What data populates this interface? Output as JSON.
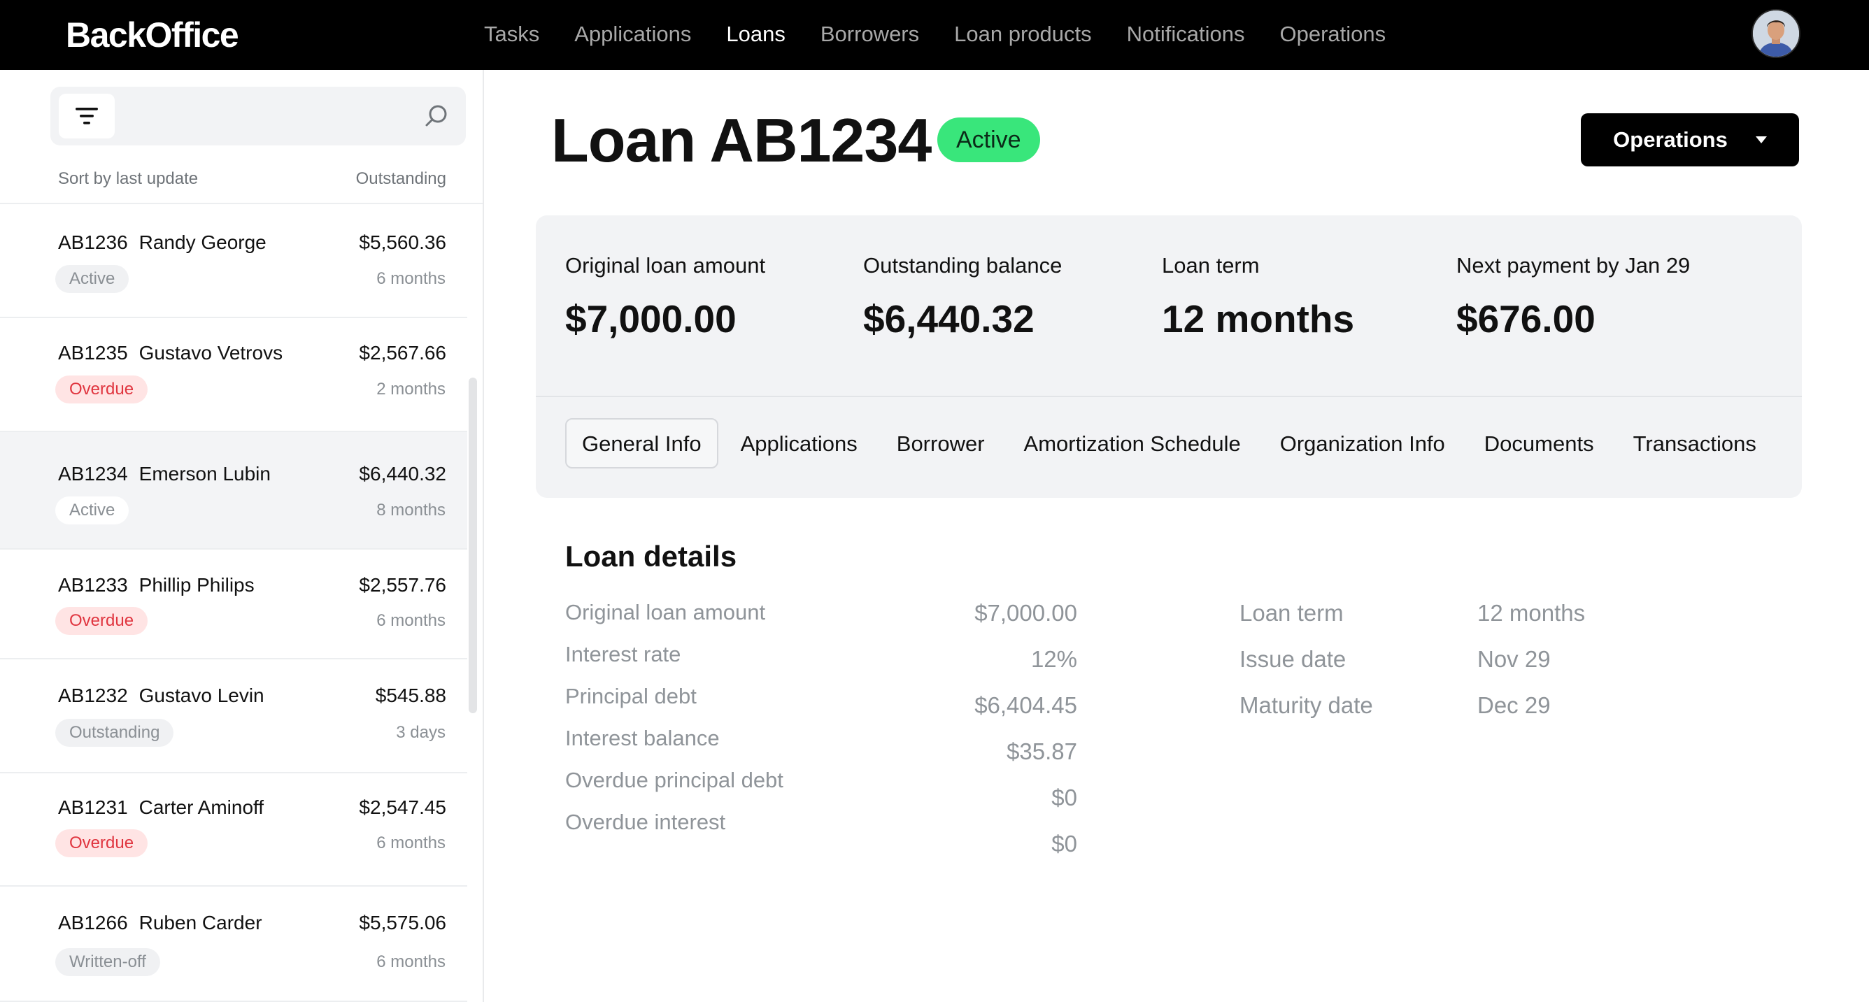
{
  "app": {
    "brand": "BackOffice"
  },
  "nav": {
    "items": [
      "Tasks",
      "Applications",
      "Loans",
      "Borrowers",
      "Loan products",
      "Notifications",
      "Operations"
    ],
    "active": "Loans"
  },
  "user": {
    "avatar": "user-avatar"
  },
  "sidebar": {
    "filter_icon": "filter-icon",
    "search_icon": "search-icon",
    "sort_label": "Sort by last update",
    "outstanding_label": "Outstanding",
    "loans": [
      {
        "id": "AB1236",
        "name": "Randy George",
        "amount": "$5,560.36",
        "status": "Active",
        "term": "6 months",
        "selected": false
      },
      {
        "id": "AB1235",
        "name": "Gustavo Vetrovs",
        "amount": "$2,567.66",
        "status": "Overdue",
        "term": "2 months",
        "selected": false
      },
      {
        "id": "AB1234",
        "name": "Emerson Lubin",
        "amount": "$6,440.32",
        "status": "Active",
        "term": "8 months",
        "selected": true
      },
      {
        "id": "AB1233",
        "name": "Phillip Philips",
        "amount": "$2,557.76",
        "status": "Overdue",
        "term": "6 months",
        "selected": false
      },
      {
        "id": "AB1232",
        "name": "Gustavo Levin",
        "amount": "$545.88",
        "status": "Outstanding",
        "term": "3 days",
        "selected": false
      },
      {
        "id": "AB1231",
        "name": "Carter Aminoff",
        "amount": "$2,547.45",
        "status": "Overdue",
        "term": "6 months",
        "selected": false
      },
      {
        "id": "AB1266",
        "name": "Ruben Carder",
        "amount": "$5,575.06",
        "status": "Written-off",
        "term": "6 months",
        "selected": false
      }
    ]
  },
  "loan": {
    "title": "Loan AB1234",
    "status": "Active",
    "status_color": "#39e67b",
    "operations_label": "Operations",
    "summary": {
      "original_label": "Original loan amount",
      "original_value": "$7,000.00",
      "outstanding_label": "Outstanding balance",
      "outstanding_value": "$6,440.32",
      "term_label": "Loan term",
      "term_value": "12 months",
      "next_label": "Next payment by Jan 29",
      "next_value": "$676.00"
    },
    "tabs": [
      "General Info",
      "Applications",
      "Borrower",
      "Amortization Schedule",
      "Organization Info",
      "Documents",
      "Transactions"
    ],
    "active_tab": "General Info",
    "details_title": "Loan details",
    "details_left": [
      {
        "label": "Original loan amount",
        "value": "$7,000.00"
      },
      {
        "label": "Interest rate",
        "value": "12%"
      },
      {
        "label": "Principal debt",
        "value": "$6,404.45"
      },
      {
        "label": "Interest balance",
        "value": "$35.87"
      },
      {
        "label": "Overdue principal debt",
        "value": "$0"
      },
      {
        "label": "Overdue interest",
        "value": "$0"
      }
    ],
    "details_right": [
      {
        "label": "Loan term",
        "value": "12 months"
      },
      {
        "label": "Issue date",
        "value": "Nov 29"
      },
      {
        "label": "Maturity date",
        "value": "Dec 29"
      }
    ]
  },
  "colors": {
    "overdue": "#e0353f",
    "overdue_bg": "#ffe4e4",
    "active_badge": "#39e67b"
  }
}
